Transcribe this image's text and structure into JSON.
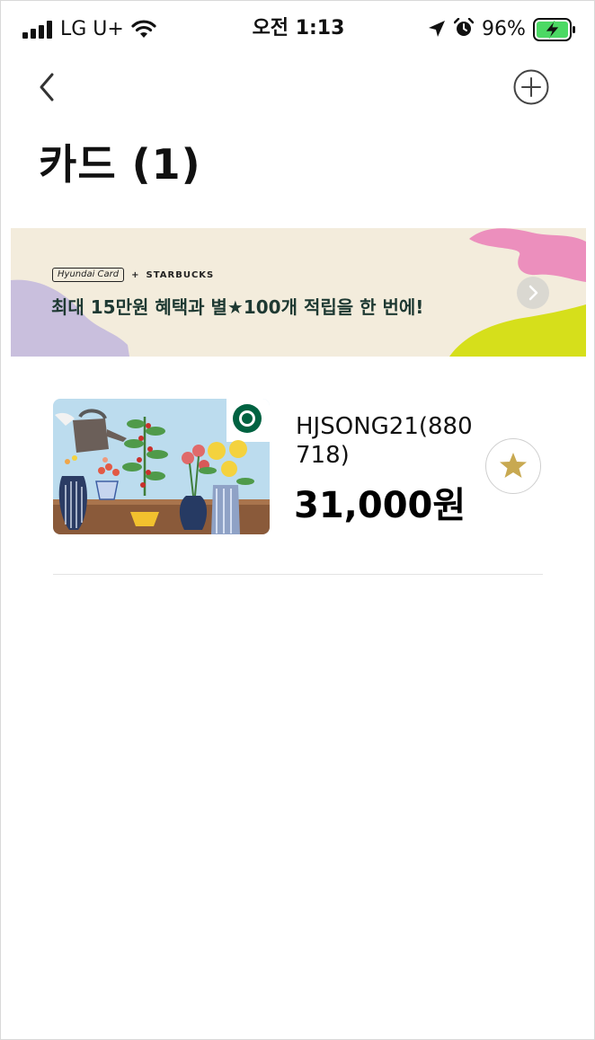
{
  "status_bar": {
    "carrier": "LG U+",
    "time": "오전 1:13",
    "battery_percent": "96%",
    "icons": [
      "signal-icon",
      "wifi-icon",
      "location-icon",
      "alarm-icon",
      "battery-charging-icon"
    ]
  },
  "nav": {
    "back_icon": "chevron-left-icon",
    "add_icon": "plus-circle-icon"
  },
  "page_title": "카드 (1)",
  "banner": {
    "brand_left": "Hyundai Card",
    "brand_plus": "+",
    "brand_right": "STARBUCKS",
    "text": "최대 15만원 혜택과 별★100개 적립을 한 번에!",
    "next_icon": "chevron-right-icon"
  },
  "cards": [
    {
      "name": "HJSONG21(880718)",
      "balance": "31,000원",
      "favorite_icon": "star-icon"
    }
  ],
  "colors": {
    "starbucks_green": "#006241",
    "star_gold": "#c8a951",
    "banner_bg": "#f3ecdc",
    "banner_text": "#1e3932"
  }
}
